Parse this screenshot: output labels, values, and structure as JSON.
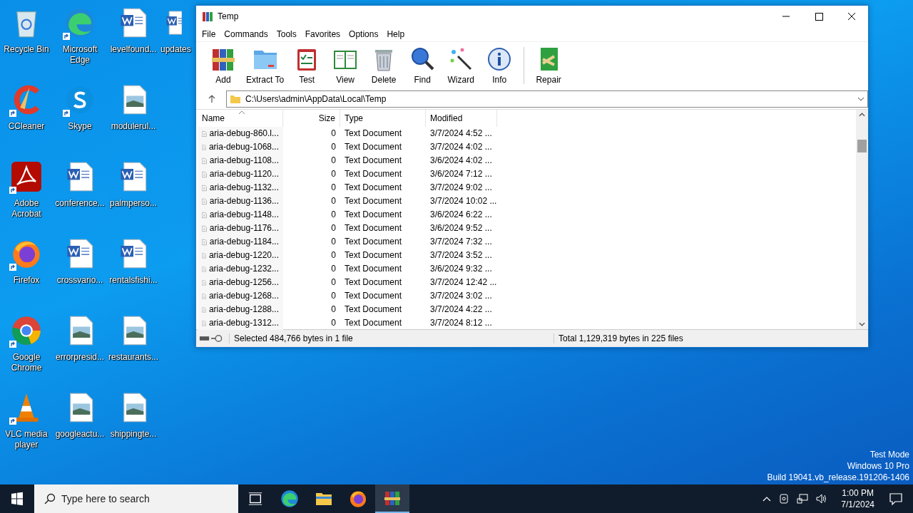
{
  "desktop_icons": [
    {
      "label": "Recycle Bin",
      "kind": "recycle",
      "shortcut": false
    },
    {
      "label": "CCleaner",
      "kind": "ccleaner",
      "shortcut": true
    },
    {
      "label": "Adobe Acrobat",
      "kind": "acrobat",
      "shortcut": true
    },
    {
      "label": "Firefox",
      "kind": "firefox",
      "shortcut": true
    },
    {
      "label": "Google Chrome",
      "kind": "chrome",
      "shortcut": true
    },
    {
      "label": "VLC media player",
      "kind": "vlc",
      "shortcut": true
    },
    {
      "label": "Microsoft Edge",
      "kind": "edge",
      "shortcut": true
    },
    {
      "label": "Skype",
      "kind": "skype",
      "shortcut": true
    },
    {
      "label": "conference...",
      "kind": "word",
      "shortcut": false
    },
    {
      "label": "crossvario...",
      "kind": "word",
      "shortcut": false
    },
    {
      "label": "errorpresid...",
      "kind": "image",
      "shortcut": false
    },
    {
      "label": "googleactu...",
      "kind": "image",
      "shortcut": false
    },
    {
      "label": "levelfound...",
      "kind": "word",
      "shortcut": false
    },
    {
      "label": "modulerul...",
      "kind": "image",
      "shortcut": false
    },
    {
      "label": "palmperso...",
      "kind": "word",
      "shortcut": false
    },
    {
      "label": "rentalsfishi...",
      "kind": "word",
      "shortcut": false
    },
    {
      "label": "restaurants...",
      "kind": "image",
      "shortcut": false
    },
    {
      "label": "shippingte...",
      "kind": "image",
      "shortcut": false
    },
    {
      "label": "updates",
      "kind": "word",
      "shortcut": false
    }
  ],
  "window": {
    "title": "Temp",
    "menu": [
      "File",
      "Commands",
      "Tools",
      "Favorites",
      "Options",
      "Help"
    ],
    "toolbar": [
      {
        "label": "Add",
        "kind": "add"
      },
      {
        "label": "Extract To",
        "kind": "extract"
      },
      {
        "label": "Test",
        "kind": "test"
      },
      {
        "label": "View",
        "kind": "view"
      },
      {
        "label": "Delete",
        "kind": "delete"
      },
      {
        "label": "Find",
        "kind": "find"
      },
      {
        "label": "Wizard",
        "kind": "wizard"
      },
      {
        "label": "Info",
        "kind": "info"
      },
      {
        "label": "Repair",
        "kind": "repair"
      }
    ],
    "address": "C:\\Users\\admin\\AppData\\Local\\Temp",
    "columns": [
      "Name",
      "Size",
      "Type",
      "Modified"
    ],
    "rows": [
      {
        "name": "aria-debug-860.l...",
        "size": "0",
        "type": "Text Document",
        "modified": "3/7/2024 4:52 ...",
        "selected": false
      },
      {
        "name": "aria-debug-1068...",
        "size": "0",
        "type": "Text Document",
        "modified": "3/7/2024 4:02 ...",
        "selected": false
      },
      {
        "name": "aria-debug-1108...",
        "size": "0",
        "type": "Text Document",
        "modified": "3/6/2024 4:02 ...",
        "selected": false
      },
      {
        "name": "aria-debug-1120...",
        "size": "0",
        "type": "Text Document",
        "modified": "3/6/2024 7:12 ...",
        "selected": false
      },
      {
        "name": "aria-debug-1132...",
        "size": "0",
        "type": "Text Document",
        "modified": "3/7/2024 9:02 ...",
        "selected": false
      },
      {
        "name": "aria-debug-1136...",
        "size": "0",
        "type": "Text Document",
        "modified": "3/7/2024 10:02 ...",
        "selected": false
      },
      {
        "name": "aria-debug-1148...",
        "size": "0",
        "type": "Text Document",
        "modified": "3/6/2024 6:22 ...",
        "selected": false
      },
      {
        "name": "aria-debug-1176...",
        "size": "0",
        "type": "Text Document",
        "modified": "3/6/2024 9:52 ...",
        "selected": false
      },
      {
        "name": "aria-debug-1184...",
        "size": "0",
        "type": "Text Document",
        "modified": "3/7/2024 7:32 ...",
        "selected": false
      },
      {
        "name": "aria-debug-1220...",
        "size": "0",
        "type": "Text Document",
        "modified": "3/7/2024 3:52 ...",
        "selected": false
      },
      {
        "name": "aria-debug-1232...",
        "size": "0",
        "type": "Text Document",
        "modified": "3/6/2024 9:32 ...",
        "selected": false
      },
      {
        "name": "aria-debug-1256...",
        "size": "0",
        "type": "Text Document",
        "modified": "3/7/2024 12:42 ...",
        "selected": false
      },
      {
        "name": "aria-debug-1268...",
        "size": "0",
        "type": "Text Document",
        "modified": "3/7/2024 3:02 ...",
        "selected": false
      },
      {
        "name": "aria-debug-1288...",
        "size": "0",
        "type": "Text Document",
        "modified": "3/7/2024 4:22 ...",
        "selected": false
      },
      {
        "name": "aria-debug-1312...",
        "size": "0",
        "type": "Text Document",
        "modified": "3/7/2024 8:12 ...",
        "selected": false
      }
    ],
    "status_left": "Selected 484,766 bytes in 1 file",
    "status_right": "Total 1,129,319 bytes in 225 files"
  },
  "watermark": [
    "Test Mode",
    "Windows 10 Pro",
    "Build 19041.vb_release.191206-1406"
  ],
  "taskbar": {
    "search_placeholder": "Type here to search",
    "apps": [
      {
        "kind": "taskview",
        "active": false
      },
      {
        "kind": "edge",
        "active": false
      },
      {
        "kind": "explorer",
        "active": false
      },
      {
        "kind": "firefox",
        "active": false
      },
      {
        "kind": "winrar",
        "active": true
      }
    ],
    "time": "1:00 PM",
    "date": "7/1/2024"
  }
}
